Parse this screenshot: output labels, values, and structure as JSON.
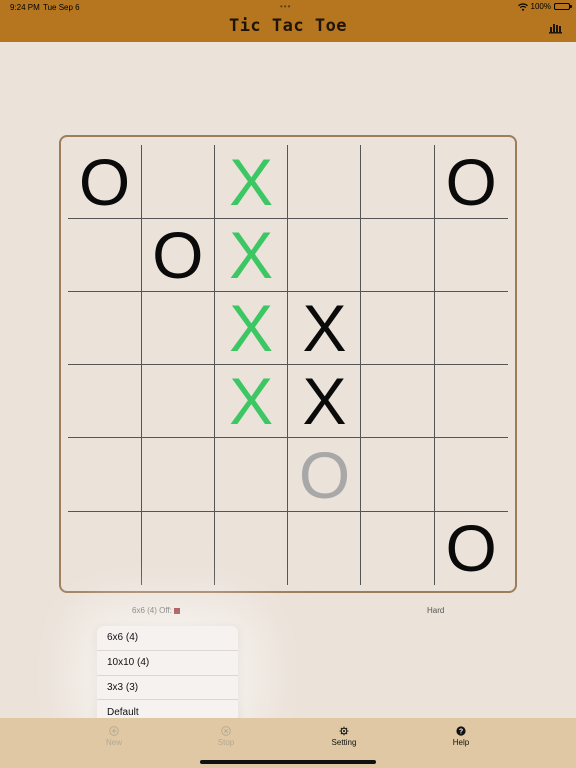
{
  "status_bar": {
    "time": "9:24 PM",
    "date": "Tue Sep 6",
    "battery": "100%",
    "dots": "•••"
  },
  "nav": {
    "title": "Tic Tac Toe",
    "stats_icon": "bar-chart-icon",
    "bar_color": "#b6761f"
  },
  "board": {
    "size": 6,
    "cells": [
      [
        "O",
        "",
        "X",
        "",
        "",
        "O"
      ],
      [
        "",
        "O",
        "X",
        "",
        "",
        ""
      ],
      [
        "",
        "",
        "X",
        "X",
        "",
        ""
      ],
      [
        "",
        "",
        "X",
        "X",
        "",
        ""
      ],
      [
        "",
        "",
        "",
        "O",
        "",
        ""
      ],
      [
        "",
        "",
        "",
        "",
        "",
        "O"
      ]
    ],
    "winning_cells": [
      [
        0,
        2
      ],
      [
        1,
        2
      ],
      [
        2,
        2
      ],
      [
        3,
        2
      ]
    ],
    "ghost_cells": [
      [
        4,
        3
      ]
    ],
    "win_color": "#3cc764",
    "ghost_color": "#a8a8a8"
  },
  "info": {
    "mode_text": "6x6 (4) Off:",
    "swatch_color": "#8b1a1a",
    "difficulty": "Hard"
  },
  "menu": {
    "items": [
      "6x6 (4)",
      "10x10 (4)",
      "3x3 (3)",
      "Default"
    ]
  },
  "toolbar": {
    "new_label": "New",
    "stop_label": "Stop",
    "setting_label": "Setting",
    "help_label": "Help"
  }
}
